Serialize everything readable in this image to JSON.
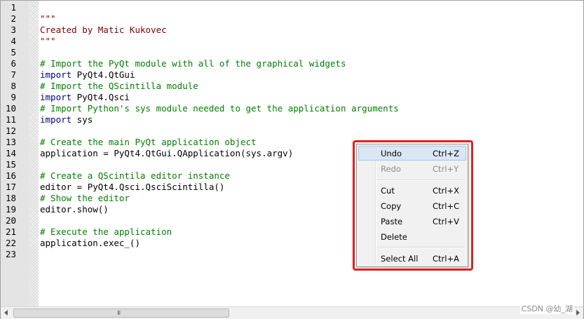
{
  "editor": {
    "line_numbers": [
      "1",
      "2",
      "3",
      "4",
      "5",
      "6",
      "7",
      "8",
      "9",
      "10",
      "11",
      "12",
      "13",
      "14",
      "15",
      "16",
      "17",
      "18",
      "19",
      "20",
      "21",
      "22",
      "23"
    ],
    "lines": {
      "l2": "\"\"\"",
      "l3": "Created by Matic Kukovec",
      "l4": "\"\"\"",
      "l6": "# Import the PyQt module with all of the graphical widgets",
      "l7_kw": "import",
      "l7_rest": " PyQt4.QtGui",
      "l8": "# Import the QScintilla module",
      "l9_kw": "import",
      "l9_rest": " PyQt4.Qsci",
      "l10": "# Import Python's sys module needed to get the application arguments",
      "l11_kw": "import",
      "l11_rest": " sys",
      "l13": "# Create the main PyQt application object",
      "l14": "application = PyQt4.QtGui.QApplication(sys.argv)",
      "l16": "# Create a QScintila editor instance",
      "l17": "editor = PyQt4.Qsci.QsciScintilla()",
      "l18": "# Show the editor",
      "l19": "editor.show()",
      "l21": "# Execute the application",
      "l22": "application.exec_()"
    }
  },
  "context_menu": {
    "items": [
      {
        "label": "Undo",
        "shortcut": "Ctrl+Z",
        "enabled": true
      },
      {
        "label": "Redo",
        "shortcut": "Ctrl+Y",
        "enabled": false
      },
      {
        "label": "Cut",
        "shortcut": "Ctrl+X",
        "enabled": true
      },
      {
        "label": "Copy",
        "shortcut": "Ctrl+C",
        "enabled": true
      },
      {
        "label": "Paste",
        "shortcut": "Ctrl+V",
        "enabled": true
      },
      {
        "label": "Delete",
        "shortcut": "",
        "enabled": true
      },
      {
        "label": "Select All",
        "shortcut": "Ctrl+A",
        "enabled": true
      }
    ],
    "highlight_color": "#e02020"
  },
  "scrollbar": {
    "grip": "III"
  },
  "watermark": "CSDN @幼_湖"
}
